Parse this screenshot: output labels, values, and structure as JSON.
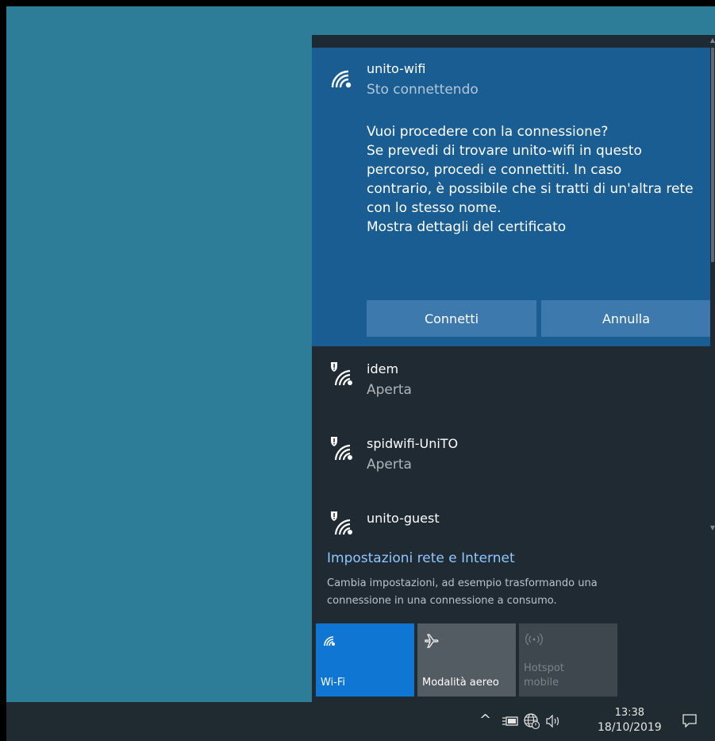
{
  "selected_network": {
    "name": "unito-wifi",
    "status": "Sto connettendo",
    "prompt_lines": [
      "Vuoi procedere con la connessione?",
      "Se prevedi di trovare unito-wifi in questo",
      "percorso, procedi e connettiti. In caso",
      "contrario, è possibile che si tratti di un'altra rete",
      "con lo stesso nome.",
      "Mostra dettagli del certificato"
    ],
    "connect_label": "Connetti",
    "cancel_label": "Annulla"
  },
  "networks": [
    {
      "name": "idem",
      "status": "Aperta"
    },
    {
      "name": "spidwifi-UniTO",
      "status": "Aperta"
    },
    {
      "name": "unito-guest",
      "status": ""
    }
  ],
  "settings": {
    "link": "Impostazioni rete e Internet",
    "desc_lines": [
      "Cambia impostazioni, ad esempio trasformando una",
      "connessione in una connessione a consumo."
    ]
  },
  "quick_actions": {
    "wifi_label": "Wi-Fi",
    "airplane_label": "Modalità aereo",
    "hotspot_label_1": "Hotspot",
    "hotspot_label_2": "mobile"
  },
  "taskbar": {
    "time": "13:38",
    "date": "18/10/2019"
  },
  "colors": {
    "desktop": "#2e7d98",
    "selected_bg": "#1a5d93",
    "button_bg": "#3d79ac",
    "link": "#8fc7ff",
    "wifi_tile": "#0f76d4"
  }
}
